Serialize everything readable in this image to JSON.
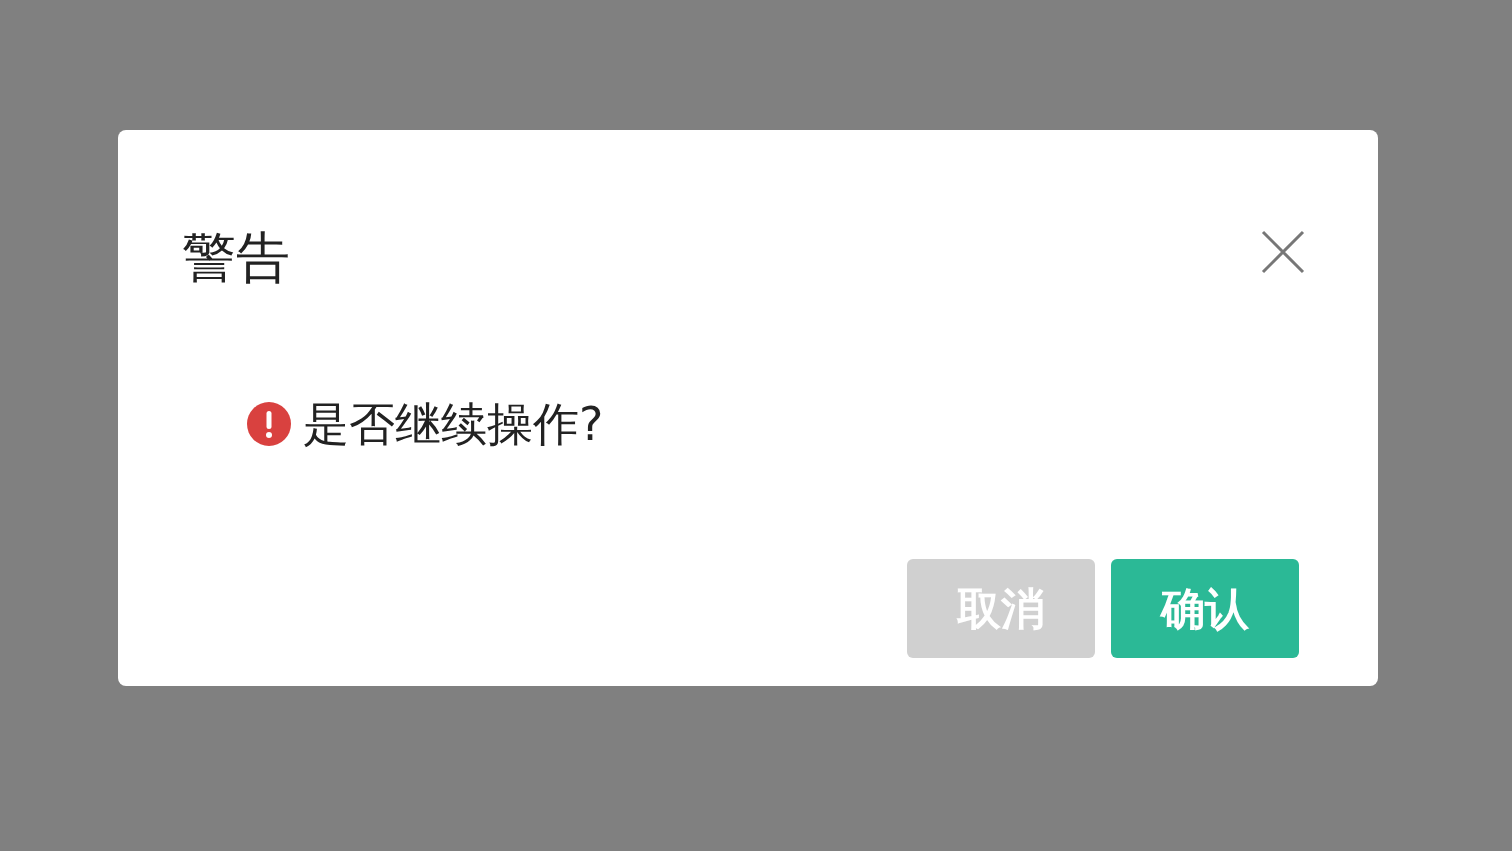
{
  "dialog": {
    "title": "警告",
    "message": "是否继续操作?",
    "buttons": [
      {
        "label": "取消",
        "kind": "secondary"
      },
      {
        "label": "确认",
        "kind": "primary"
      }
    ]
  }
}
